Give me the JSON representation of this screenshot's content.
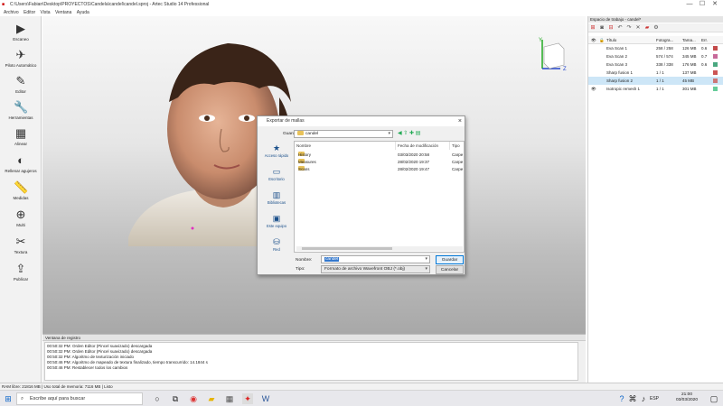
{
  "window": {
    "title": "C:\\Users\\Fabian\\Desktop\\PROYECTOS\\Candela\\candel\\candel.sproj - Artec Studio 14 Professional",
    "controls": {
      "minimize": "—",
      "maximize": "☐",
      "close": "✕"
    }
  },
  "menu": [
    "Archivo",
    "Editor",
    "Vista",
    "Ventana",
    "Ayuda"
  ],
  "toolbox": [
    {
      "label": "Escaneo",
      "icon": "play-circle-icon",
      "glyph": "▶"
    },
    {
      "label": "Piloto Automático",
      "icon": "autopilot-icon",
      "glyph": "✈"
    },
    {
      "label": "Editor",
      "icon": "eraser-icon",
      "glyph": "✎"
    },
    {
      "label": "Herramientas",
      "icon": "wrench-icon",
      "glyph": "🔧"
    },
    {
      "label": "Alinear",
      "icon": "align-icon",
      "glyph": "▦"
    },
    {
      "label": "Rellenar agujeros",
      "icon": "fill-holes-icon",
      "glyph": "◐"
    },
    {
      "label": "Medidas",
      "icon": "ruler-icon",
      "glyph": "📏"
    },
    {
      "label": "Multi",
      "icon": "multi-icon",
      "glyph": "⊕"
    },
    {
      "label": "Textura",
      "icon": "texture-icon",
      "glyph": "✂"
    },
    {
      "label": "Publicar",
      "icon": "publish-icon",
      "glyph": "⇪"
    }
  ],
  "log": {
    "title": "Ventana de registro",
    "lines": [
      "00:50:32 PM: Orden Editor (Pincel suavizado) descargada",
      "00:50:32 PM: Orden Editor (Pincel suavizado) descargada",
      "00:50:32 PM: Algoritmo de texturización iniciado",
      "00:50:46 PM: Algoritmo de mapeado de textura finalizado, tiempo transcurrido: 14.1844 s",
      "00:50:46 PM: Restablecer todos los cambios"
    ]
  },
  "status": {
    "ram": "RAM libre: 21816 MB",
    "memory": "Uso total de memoria: 7116 MB",
    "state": "Listo"
  },
  "workspace": {
    "title": "Espacio de trabajo - candel*",
    "toolbar_icons": [
      "import-icon",
      "camera-icon",
      "export-icon",
      "undo-icon",
      "redo-icon",
      "delete-icon",
      "folder-icon",
      "gear-icon"
    ],
    "columns": [
      "Título",
      "Fotogra...",
      "Tama...",
      "Err."
    ],
    "rows": [
      {
        "eye": "",
        "name": "Eva Scan 1",
        "frames": "258 / 258",
        "size": "126 MB",
        "err": "0.6",
        "color": "#c44b4b",
        "selected": false
      },
      {
        "eye": "",
        "name": "Eva Scan 2",
        "frames": "574 / 574",
        "size": "345 MB",
        "err": "0.7",
        "color": "#c86a9a",
        "selected": false
      },
      {
        "eye": "",
        "name": "Eva Scan 3",
        "frames": "338 / 338",
        "size": "176 MB",
        "err": "0.6",
        "color": "#4aa880",
        "selected": false
      },
      {
        "eye": "",
        "name": "Sharp fusion 1",
        "frames": "1 / 1",
        "size": "137 MB",
        "err": "",
        "color": "#c55",
        "selected": false
      },
      {
        "eye": "",
        "name": "Sharp fusion 2",
        "frames": "1 / 1",
        "size": "45 MB",
        "err": "",
        "color": "#c77",
        "selected": true
      },
      {
        "eye": "👁",
        "name": "Isotropic remesh 1",
        "frames": "1 / 1",
        "size": "301 MB",
        "err": "",
        "color": "#6c9",
        "selected": false
      }
    ]
  },
  "dialog": {
    "title": "Exportar de mallas",
    "save_in_label": "Guardar en:",
    "save_in_value": "candel",
    "places": [
      {
        "label": "Acceso rápido",
        "icon": "star-icon",
        "glyph": "★"
      },
      {
        "label": "Escritorio",
        "icon": "desktop-icon",
        "glyph": "▭"
      },
      {
        "label": "Bibliotecas",
        "icon": "library-icon",
        "glyph": "▥"
      },
      {
        "label": "Este equipo",
        "icon": "computer-icon",
        "glyph": "▣"
      },
      {
        "label": "Red",
        "icon": "network-icon",
        "glyph": "⛁"
      }
    ],
    "columns": [
      "Nombre",
      "Fecha de modificación",
      "Tipo"
    ],
    "files": [
      {
        "name": "History",
        "date": "03/03/2020 20:58",
        "type": "Carpe"
      },
      {
        "name": "Measures",
        "date": "28/02/2020 19:37",
        "type": "Carpe"
      },
      {
        "name": "Scans",
        "date": "28/02/2020 19:47",
        "type": "Carpe"
      }
    ],
    "filename_label": "Nombre:",
    "filename_value": "candel",
    "type_label": "Tipo:",
    "type_value": "Formato de archivo Wavefront OBJ (*.obj)",
    "save_button": "Guardar",
    "cancel_button": "Cancelar"
  },
  "taskbar": {
    "search_placeholder": "Escribe aquí para buscar",
    "lang": "ESP",
    "time": "21:00",
    "date": "03/03/2020"
  }
}
